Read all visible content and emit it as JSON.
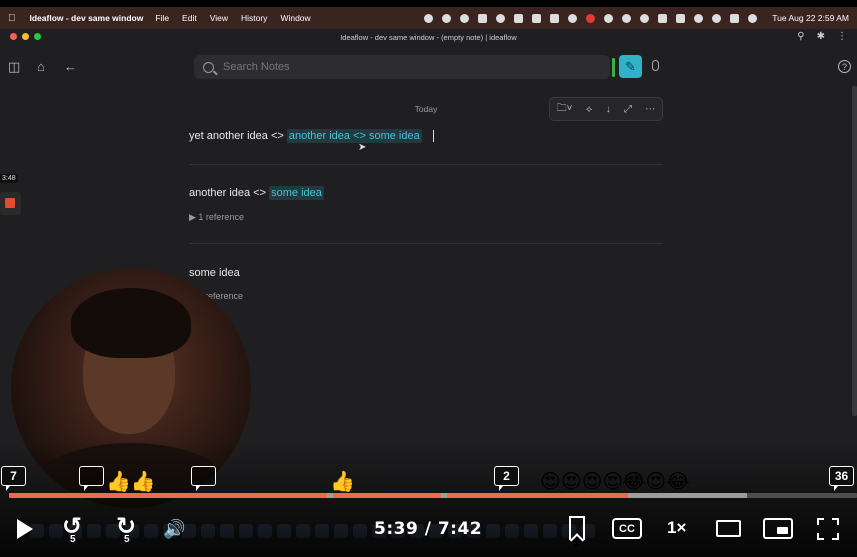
{
  "menubar": {
    "app_name": "Ideaflow - dev same window",
    "menus": [
      "File",
      "Edit",
      "View",
      "History",
      "Window"
    ],
    "clock": "Tue Aug 22  2:59 AM"
  },
  "window": {
    "title": "Ideaflow - dev same window - (empty note) | ideaflow"
  },
  "search": {
    "placeholder": "Search Notes"
  },
  "feed": {
    "date_label": "Today",
    "notes": [
      {
        "text": "yet another idea <>",
        "tag": "another idea <> some idea"
      },
      {
        "text": "another idea <>",
        "tag": "some idea",
        "refs": "▶ 1 reference"
      },
      {
        "text": "some idea",
        "refs": "reference"
      }
    ]
  },
  "side_widget": {
    "time": "3:48"
  },
  "player": {
    "time_display": "5:39 / 7:42",
    "skip_back_seconds": "5",
    "skip_forward_seconds": "5",
    "speed": "1×",
    "cc_label": "CC",
    "progress_fraction": 0.73,
    "buffered_fraction": 0.87,
    "comment_counts": [
      "7",
      "2",
      "36"
    ],
    "reactions": {
      "thumbs_a": "👍👍",
      "thumbs_b": "👍",
      "hearts": "😍😍😍😍😍",
      "laughs": "😂😍😂"
    }
  },
  "colors": {
    "accent": "#2fb3c9",
    "progress": "#ec6b4c",
    "background": "#1f1f21"
  }
}
